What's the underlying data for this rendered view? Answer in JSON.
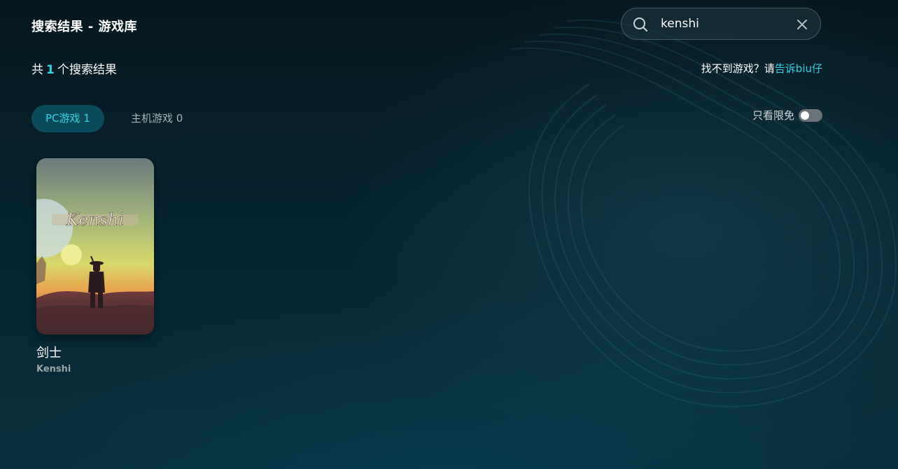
{
  "header": {
    "title": "搜索结果 - 游戏库"
  },
  "search": {
    "value": "kenshi",
    "placeholder": ""
  },
  "results": {
    "prefix": "共",
    "count": "1",
    "suffix": "个搜索结果"
  },
  "feedback": {
    "text": "找不到游戏？请",
    "link": "告诉biu仔"
  },
  "tabs": [
    {
      "label": "PC游戏 1",
      "active": true
    },
    {
      "label": "主机游戏 0",
      "active": false
    }
  ],
  "filter": {
    "label": "只看限免",
    "enabled": false
  },
  "games": [
    {
      "title_cn": "剑士",
      "title_en": "Kenshi",
      "cover_logo": "Kenshi"
    }
  ],
  "colors": {
    "accent": "#2fd3e6",
    "tab_active_bg": "#0b4a5a",
    "background": "#062430"
  }
}
